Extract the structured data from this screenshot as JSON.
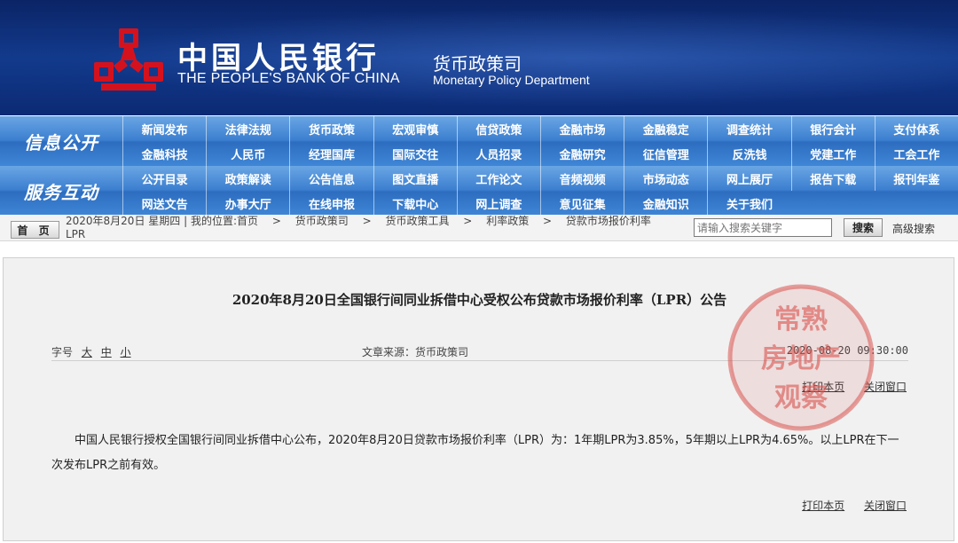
{
  "header": {
    "bank_name_cn": "中国人民银行",
    "bank_name_en": "THE PEOPLE'S BANK OF CHINA",
    "dept_cn": "货币政策司",
    "dept_en": "Monetary Policy Department"
  },
  "nav": [
    {
      "title": "信息公开",
      "items": [
        "新闻发布",
        "法律法规",
        "货币政策",
        "宏观审慎",
        "信贷政策",
        "金融市场",
        "金融稳定",
        "调查统计",
        "银行会计",
        "支付体系",
        "金融科技",
        "人民币",
        "经理国库",
        "国际交往",
        "人员招录",
        "金融研究",
        "征信管理",
        "反洗钱",
        "党建工作",
        "工会工作"
      ]
    },
    {
      "title": "服务互动",
      "items": [
        "公开目录",
        "政策解读",
        "公告信息",
        "图文直播",
        "工作论文",
        "音频视频",
        "市场动态",
        "网上展厅",
        "报告下载",
        "报刊年鉴",
        "网送文告",
        "办事大厅",
        "在线申报",
        "下载中心",
        "网上调查",
        "意见征集",
        "金融知识",
        "关于我们"
      ]
    }
  ],
  "breadcrumb": {
    "home_label": "首 页",
    "date": "2020年8月20日 星期四",
    "location_label": "我的位置:首页",
    "path": [
      "货币政策司",
      "货币政策工具",
      "利率政策",
      "贷款市场报价利率"
    ],
    "trailing": "LPR",
    "separator": ">"
  },
  "search": {
    "placeholder": "请输入搜索关键字",
    "button_label": "搜索",
    "advanced_label": "高级搜索"
  },
  "article": {
    "title": "2020年8月20日全国银行间同业拆借中心受权公布贷款市场报价利率（LPR）公告",
    "font_size_label": "字号",
    "font_sizes": [
      "大",
      "中",
      "小"
    ],
    "source": "文章来源：货币政策司",
    "datetime": "2020-08-20 09:30:00",
    "print_label": "打印本页",
    "close_label": "关闭窗口",
    "body": "中国人民银行授权全国银行间同业拆借中心公布，2020年8月20日贷款市场报价利率（LPR）为：1年期LPR为3.85%，5年期以上LPR为4.65%。以上LPR在下一次发布LPR之前有效。"
  },
  "watermark": {
    "text_line1": "常熟",
    "text_line2": "房地产",
    "text_line3": "观察"
  },
  "colors": {
    "header_bg": "#123a8c",
    "nav_bg": "#3c7fd0",
    "logo_red": "#d4121e",
    "stamp_red": "#d9534f"
  }
}
